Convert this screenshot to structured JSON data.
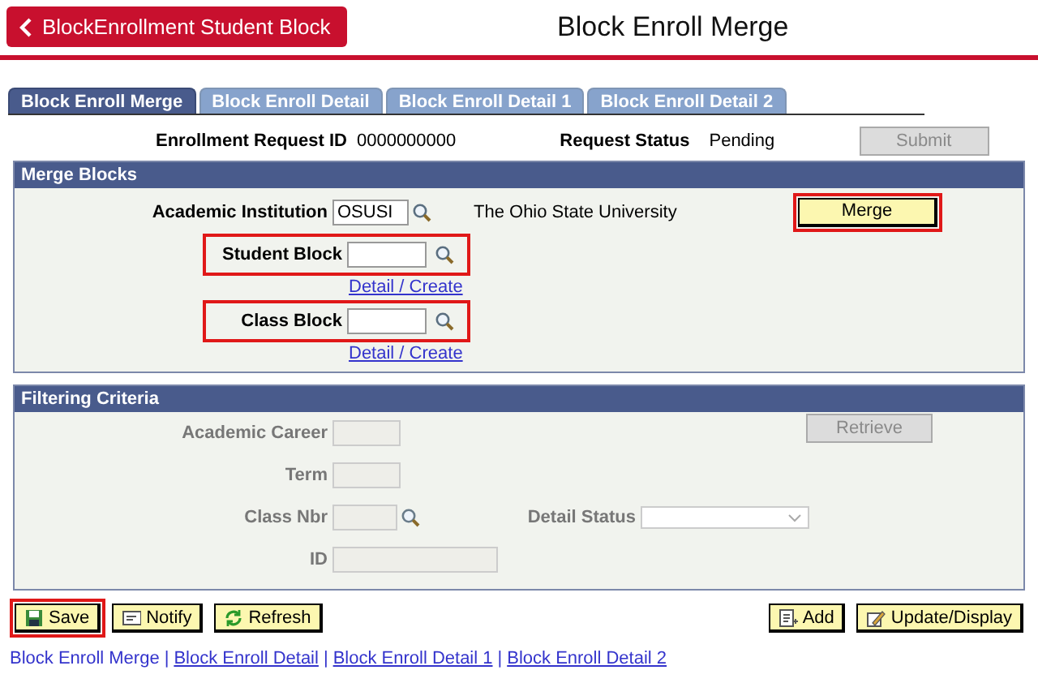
{
  "header": {
    "back_button": "BlockEnrollment Student Block",
    "title": "Block Enroll Merge"
  },
  "tabs": [
    {
      "label": "Block Enroll Merge",
      "selected": true
    },
    {
      "label": "Block Enroll Detail",
      "selected": false
    },
    {
      "label": "Block Enroll Detail 1",
      "selected": false
    },
    {
      "label": "Block Enroll Detail 2",
      "selected": false
    }
  ],
  "request": {
    "id_label": "Enrollment Request ID",
    "id_value": "0000000000",
    "status_label": "Request Status",
    "status_value": "Pending",
    "submit_button": {
      "label": "Submit",
      "disabled": true
    }
  },
  "merge_blocks": {
    "title": "Merge Blocks",
    "institution": {
      "label": "Academic Institution",
      "value": "OSUSI",
      "description": "The Ohio State University"
    },
    "fields": [
      {
        "label": "Student Block",
        "link": "Detail / Create",
        "highlighted": true
      },
      {
        "label": "Class Block",
        "link": "Detail / Create",
        "highlighted": true
      }
    ],
    "merge_button": {
      "label": "Merge",
      "highlighted": true
    }
  },
  "filtering": {
    "title": "Filtering Criteria",
    "retrieve_button": {
      "label": "Retrieve",
      "disabled": true
    },
    "fields": [
      {
        "kind": "short",
        "label": "Academic Career",
        "disabled": true
      },
      {
        "kind": "short",
        "label": "Term",
        "disabled": true
      },
      {
        "kind": "lookup",
        "label": "Class Nbr",
        "disabled": true
      },
      {
        "kind": "long",
        "label": "ID",
        "disabled": true
      }
    ],
    "detail_status": {
      "label": "Detail Status",
      "disabled": true
    }
  },
  "toolbar": {
    "left": [
      {
        "kind": "save",
        "label": "Save",
        "highlighted": true
      },
      {
        "kind": "notify",
        "label": "Notify",
        "highlighted": false
      },
      {
        "kind": "refresh",
        "label": "Refresh",
        "highlighted": false
      }
    ],
    "right": [
      {
        "kind": "add",
        "label": "Add",
        "highlighted": false
      },
      {
        "kind": "update",
        "label": "Update/Display",
        "highlighted": false
      }
    ]
  },
  "footer": [
    {
      "kind": "link",
      "label": "Block Enroll Merge",
      "selected": true
    },
    {
      "kind": "separator",
      "label": "|"
    },
    {
      "kind": "link",
      "label": "Block Enroll Detail",
      "selected": false
    },
    {
      "kind": "separator",
      "label": "|"
    },
    {
      "kind": "link",
      "label": "Block Enroll Detail 1",
      "selected": false
    },
    {
      "kind": "separator",
      "label": "|"
    },
    {
      "kind": "link",
      "label": "Block Enroll Detail 2",
      "selected": false
    }
  ]
}
